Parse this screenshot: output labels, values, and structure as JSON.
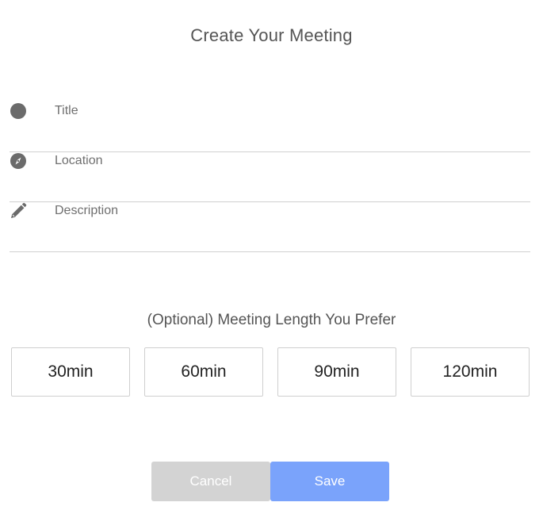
{
  "header": {
    "title": "Create Your Meeting"
  },
  "form": {
    "title_field": {
      "icon": "circle-icon",
      "placeholder": "Title",
      "value": ""
    },
    "location_field": {
      "icon": "compass-icon",
      "placeholder": "Location",
      "value": ""
    },
    "description_field": {
      "icon": "pencil-icon",
      "placeholder": "Description",
      "value": ""
    }
  },
  "length": {
    "heading": "(Optional) Meeting Length You Prefer",
    "options": [
      "30min",
      "60min",
      "90min",
      "120min"
    ]
  },
  "actions": {
    "cancel_label": "Cancel",
    "save_label": "Save"
  },
  "colors": {
    "icon": "#6b6b6b",
    "divider": "#d0d0d0",
    "cancel_bg": "#d3d3d3",
    "save_bg": "#7aa3fb",
    "option_border": "#cfcfcf"
  }
}
